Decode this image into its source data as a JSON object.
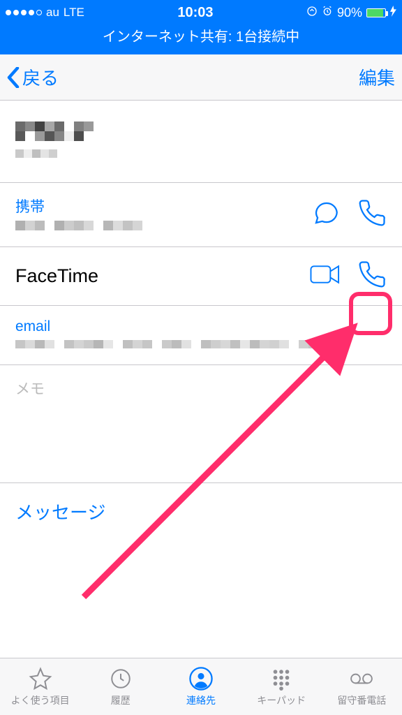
{
  "status": {
    "carrier": "au",
    "network": "LTE",
    "time": "10:03",
    "battery_pct": "90%",
    "tether": "インターネット共有: 1台接続中"
  },
  "nav": {
    "back": "戻る",
    "edit": "編集"
  },
  "contact": {
    "name_obscured": true,
    "company_obscured": true,
    "phone_label": "携帯",
    "phone_value_obscured": true,
    "facetime_label": "FaceTime",
    "email_label": "email",
    "email_value_obscured": true,
    "memo_label": "メモ",
    "message_action": "メッセージ"
  },
  "tabs": {
    "favorites": "よく使う項目",
    "recents": "履歴",
    "contacts": "連絡先",
    "keypad": "キーパッド",
    "voicemail": "留守番電話"
  },
  "colors": {
    "accent": "#007aff",
    "highlight": "#ff2d6b",
    "battery_fill": "#4cd964"
  }
}
